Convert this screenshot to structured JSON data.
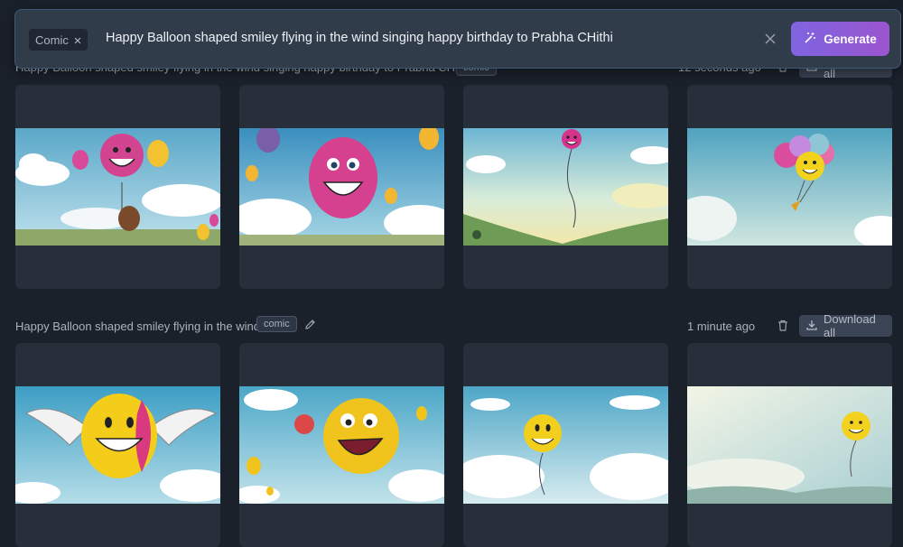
{
  "prompt": {
    "style_chip": "Comic",
    "text": "Happy Balloon shaped smiley flying in the wind singing happy birthday to Prabha CHithi",
    "generate_label": "Generate"
  },
  "groups": [
    {
      "title": "Happy Balloon shaped smiley flying in the wind singing happy birthday to Prabha CHithi",
      "badge": "comic",
      "time": "12 seconds ago",
      "download_label": "Download all"
    },
    {
      "title": "Happy Balloon shaped smiley flying in the wind",
      "badge": "comic",
      "time": "1 minute ago",
      "download_label": "Download all"
    }
  ],
  "colors": {
    "background": "#1b212b",
    "card": "#272f3b",
    "accent_start": "#7f64e0",
    "accent_end": "#9b55cf"
  },
  "icons": [
    "close-icon",
    "clear-icon",
    "magic-wand-icon",
    "edit-icon",
    "trash-icon",
    "download-icon"
  ]
}
